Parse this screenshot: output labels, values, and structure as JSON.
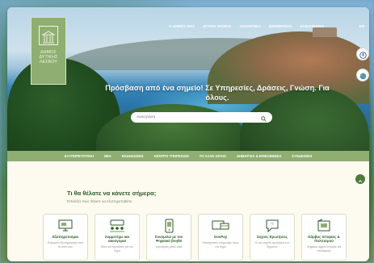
{
  "logo": {
    "lines": [
      "ΔΗΜΟΣ",
      "ΔΥΤΙΚΗΣ",
      "ΛΕΣΒΟΥ"
    ]
  },
  "topnav": [
    "Ο ΔΗΜΟΣ ΜΑΣ",
    "ΔΥΤΙΚΗ ΛΕΣΒΟΣ",
    "ΟΙΚΟΝΟΜΙΑ",
    "ΕΝΗΜΕΡΩΣΗ",
    "ΕΠΙΚΟΙΝΩΝΙΑ"
  ],
  "language": "EN",
  "hero": {
    "headline": "Πρόσβαση από ένα σημείο! Σε Υπηρεσίες, Δράσεις, Γνώση. Για όλους.",
    "search_placeholder": "Αναζήτηση"
  },
  "mainnav": [
    "ΕΞΥΠΗΡΕΤΟΥΜΑΙ",
    "ΝΕΑ",
    "ΕΚΔΗΛΩΣΕΙΣ",
    "ΚΕΝΤΡΟ ΥΠΗΡΕΣΙΩΝ",
    "ΤΟ ΑΛΛΟ ΑΙΓΑΙΟ",
    "ΔΗΜΑΡΧΙΑ & ΕΠΙΚΟΙΝΩΝΙΑ",
    "ΣΥΝΔΕΣΜΟΙ"
  ],
  "section": {
    "title": "Τι θα θέλατε να κάνετε σήμερα;",
    "subtitle": "Επιλέξτε πώς θέλετε να εξυπηρετηθείτε."
  },
  "cards": [
    {
      "title": "Εξυπηρετούμαι",
      "desc": "Ενέργειες εξυπηρέτησης από το σπίτι σας",
      "icon": "monitor-icon"
    },
    {
      "title": "Συμμετέχω και ακούγομαι",
      "desc": "Ιδέες και προτάσεις για τον δήμο",
      "icon": "people-icon"
    },
    {
      "title": "Συνομιλώ με τον Ψηφιακό βοηθό",
      "desc": "Ερωτήσεις μέσω chat",
      "icon": "phone-icon"
    },
    {
      "title": "GovPay",
      "desc": "Ηλεκτρονικές πληρωμές προς τον δήμο",
      "icon": "payment-icon"
    },
    {
      "title": "Συχνές Ερωτήσεις",
      "desc": "Οι πιο συχνές ερωτήσεις των δημοτών",
      "icon": "question-icon"
    },
    {
      "title": "Κάμβος Ιστορίας & Πολιτισμού",
      "desc": "Ψηφιακό αρχείο ιστορίας και πολιτισμού",
      "icon": "archive-icon"
    }
  ],
  "colors": {
    "brand_green": "#8fae72",
    "dark_green": "#2e5a2a",
    "background": "#fdfbef"
  }
}
